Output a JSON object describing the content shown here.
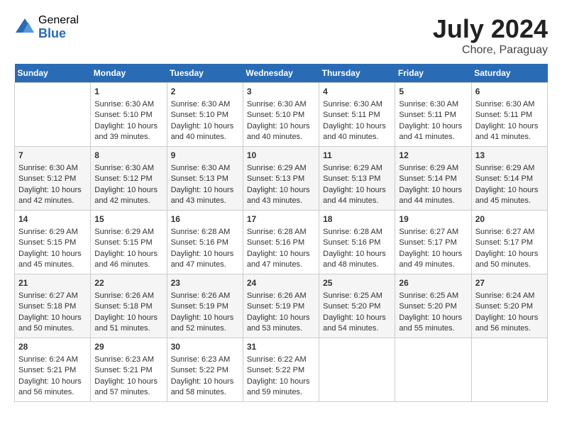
{
  "header": {
    "logo_general": "General",
    "logo_blue": "Blue",
    "title": "July 2024",
    "location": "Chore, Paraguay"
  },
  "weekdays": [
    "Sunday",
    "Monday",
    "Tuesday",
    "Wednesday",
    "Thursday",
    "Friday",
    "Saturday"
  ],
  "weeks": [
    [
      {
        "day": "",
        "lines": []
      },
      {
        "day": "1",
        "lines": [
          "Sunrise: 6:30 AM",
          "Sunset: 5:10 PM",
          "Daylight: 10 hours",
          "and 39 minutes."
        ]
      },
      {
        "day": "2",
        "lines": [
          "Sunrise: 6:30 AM",
          "Sunset: 5:10 PM",
          "Daylight: 10 hours",
          "and 40 minutes."
        ]
      },
      {
        "day": "3",
        "lines": [
          "Sunrise: 6:30 AM",
          "Sunset: 5:10 PM",
          "Daylight: 10 hours",
          "and 40 minutes."
        ]
      },
      {
        "day": "4",
        "lines": [
          "Sunrise: 6:30 AM",
          "Sunset: 5:11 PM",
          "Daylight: 10 hours",
          "and 40 minutes."
        ]
      },
      {
        "day": "5",
        "lines": [
          "Sunrise: 6:30 AM",
          "Sunset: 5:11 PM",
          "Daylight: 10 hours",
          "and 41 minutes."
        ]
      },
      {
        "day": "6",
        "lines": [
          "Sunrise: 6:30 AM",
          "Sunset: 5:11 PM",
          "Daylight: 10 hours",
          "and 41 minutes."
        ]
      }
    ],
    [
      {
        "day": "7",
        "lines": [
          "Sunrise: 6:30 AM",
          "Sunset: 5:12 PM",
          "Daylight: 10 hours",
          "and 42 minutes."
        ]
      },
      {
        "day": "8",
        "lines": [
          "Sunrise: 6:30 AM",
          "Sunset: 5:12 PM",
          "Daylight: 10 hours",
          "and 42 minutes."
        ]
      },
      {
        "day": "9",
        "lines": [
          "Sunrise: 6:30 AM",
          "Sunset: 5:13 PM",
          "Daylight: 10 hours",
          "and 43 minutes."
        ]
      },
      {
        "day": "10",
        "lines": [
          "Sunrise: 6:29 AM",
          "Sunset: 5:13 PM",
          "Daylight: 10 hours",
          "and 43 minutes."
        ]
      },
      {
        "day": "11",
        "lines": [
          "Sunrise: 6:29 AM",
          "Sunset: 5:13 PM",
          "Daylight: 10 hours",
          "and 44 minutes."
        ]
      },
      {
        "day": "12",
        "lines": [
          "Sunrise: 6:29 AM",
          "Sunset: 5:14 PM",
          "Daylight: 10 hours",
          "and 44 minutes."
        ]
      },
      {
        "day": "13",
        "lines": [
          "Sunrise: 6:29 AM",
          "Sunset: 5:14 PM",
          "Daylight: 10 hours",
          "and 45 minutes."
        ]
      }
    ],
    [
      {
        "day": "14",
        "lines": [
          "Sunrise: 6:29 AM",
          "Sunset: 5:15 PM",
          "Daylight: 10 hours",
          "and 45 minutes."
        ]
      },
      {
        "day": "15",
        "lines": [
          "Sunrise: 6:29 AM",
          "Sunset: 5:15 PM",
          "Daylight: 10 hours",
          "and 46 minutes."
        ]
      },
      {
        "day": "16",
        "lines": [
          "Sunrise: 6:28 AM",
          "Sunset: 5:16 PM",
          "Daylight: 10 hours",
          "and 47 minutes."
        ]
      },
      {
        "day": "17",
        "lines": [
          "Sunrise: 6:28 AM",
          "Sunset: 5:16 PM",
          "Daylight: 10 hours",
          "and 47 minutes."
        ]
      },
      {
        "day": "18",
        "lines": [
          "Sunrise: 6:28 AM",
          "Sunset: 5:16 PM",
          "Daylight: 10 hours",
          "and 48 minutes."
        ]
      },
      {
        "day": "19",
        "lines": [
          "Sunrise: 6:27 AM",
          "Sunset: 5:17 PM",
          "Daylight: 10 hours",
          "and 49 minutes."
        ]
      },
      {
        "day": "20",
        "lines": [
          "Sunrise: 6:27 AM",
          "Sunset: 5:17 PM",
          "Daylight: 10 hours",
          "and 50 minutes."
        ]
      }
    ],
    [
      {
        "day": "21",
        "lines": [
          "Sunrise: 6:27 AM",
          "Sunset: 5:18 PM",
          "Daylight: 10 hours",
          "and 50 minutes."
        ]
      },
      {
        "day": "22",
        "lines": [
          "Sunrise: 6:26 AM",
          "Sunset: 5:18 PM",
          "Daylight: 10 hours",
          "and 51 minutes."
        ]
      },
      {
        "day": "23",
        "lines": [
          "Sunrise: 6:26 AM",
          "Sunset: 5:19 PM",
          "Daylight: 10 hours",
          "and 52 minutes."
        ]
      },
      {
        "day": "24",
        "lines": [
          "Sunrise: 6:26 AM",
          "Sunset: 5:19 PM",
          "Daylight: 10 hours",
          "and 53 minutes."
        ]
      },
      {
        "day": "25",
        "lines": [
          "Sunrise: 6:25 AM",
          "Sunset: 5:20 PM",
          "Daylight: 10 hours",
          "and 54 minutes."
        ]
      },
      {
        "day": "26",
        "lines": [
          "Sunrise: 6:25 AM",
          "Sunset: 5:20 PM",
          "Daylight: 10 hours",
          "and 55 minutes."
        ]
      },
      {
        "day": "27",
        "lines": [
          "Sunrise: 6:24 AM",
          "Sunset: 5:20 PM",
          "Daylight: 10 hours",
          "and 56 minutes."
        ]
      }
    ],
    [
      {
        "day": "28",
        "lines": [
          "Sunrise: 6:24 AM",
          "Sunset: 5:21 PM",
          "Daylight: 10 hours",
          "and 56 minutes."
        ]
      },
      {
        "day": "29",
        "lines": [
          "Sunrise: 6:23 AM",
          "Sunset: 5:21 PM",
          "Daylight: 10 hours",
          "and 57 minutes."
        ]
      },
      {
        "day": "30",
        "lines": [
          "Sunrise: 6:23 AM",
          "Sunset: 5:22 PM",
          "Daylight: 10 hours",
          "and 58 minutes."
        ]
      },
      {
        "day": "31",
        "lines": [
          "Sunrise: 6:22 AM",
          "Sunset: 5:22 PM",
          "Daylight: 10 hours",
          "and 59 minutes."
        ]
      },
      {
        "day": "",
        "lines": []
      },
      {
        "day": "",
        "lines": []
      },
      {
        "day": "",
        "lines": []
      }
    ]
  ]
}
